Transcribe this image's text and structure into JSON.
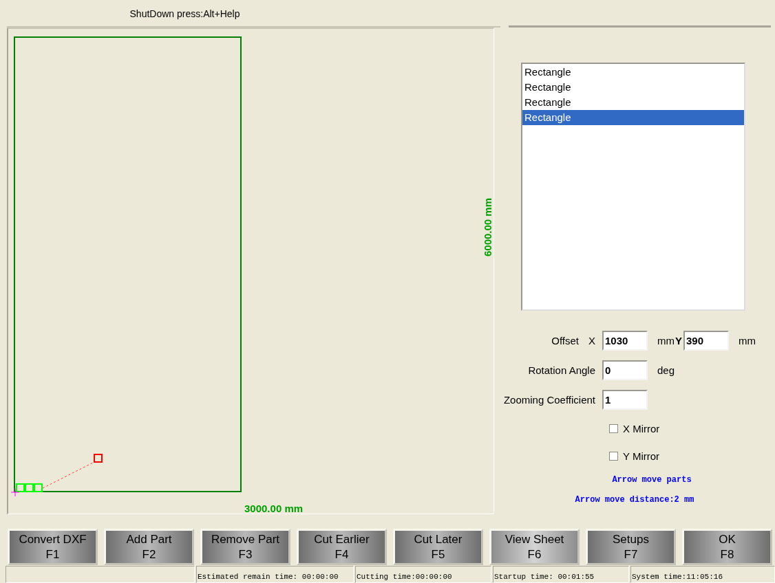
{
  "header": {
    "title": "ShutDown press:Alt+Help"
  },
  "canvas": {
    "width_label": "3000.00 mm",
    "height_label": "6000.00 mm"
  },
  "parts_list": {
    "items": [
      {
        "label": "Rectangle",
        "selected": false
      },
      {
        "label": "Rectangle",
        "selected": false
      },
      {
        "label": "Rectangle",
        "selected": false
      },
      {
        "label": "Rectangle",
        "selected": true
      }
    ]
  },
  "offset": {
    "label": "Offset",
    "x_label": "X",
    "x_value": "1030",
    "x_unit": "mm",
    "y_label": "Y",
    "y_value": "390",
    "y_unit": "mm"
  },
  "rotation": {
    "label": "Rotation Angle",
    "value": "0",
    "unit": "deg"
  },
  "zoom": {
    "label": "Zooming Coefficient",
    "value": "1"
  },
  "mirrors": [
    {
      "label": "X Mirror",
      "checked": false
    },
    {
      "label": "Y Mirror",
      "checked": false
    }
  ],
  "hints": [
    "Arrow move parts",
    "Arrow move distance:2 mm"
  ],
  "function_keys": [
    {
      "label": "Convert DXF",
      "key": "F1",
      "selected": false
    },
    {
      "label": "Add Part",
      "key": "F2",
      "selected": false
    },
    {
      "label": "Remove Part",
      "key": "F3",
      "selected": false
    },
    {
      "label": "Cut Earlier",
      "key": "F4",
      "selected": false
    },
    {
      "label": "Cut Later",
      "key": "F5",
      "selected": false
    },
    {
      "label": "View Sheet",
      "key": "F6",
      "selected": true
    },
    {
      "label": "Setups",
      "key": "F7",
      "selected": false
    },
    {
      "label": "OK",
      "key": "F8",
      "selected": false
    }
  ],
  "status_bar": [
    "Estimated remain time: 00:00:00",
    "Cutting time:00:00:00",
    "Startup time: 00:01:55",
    "System time:11:05:16"
  ]
}
